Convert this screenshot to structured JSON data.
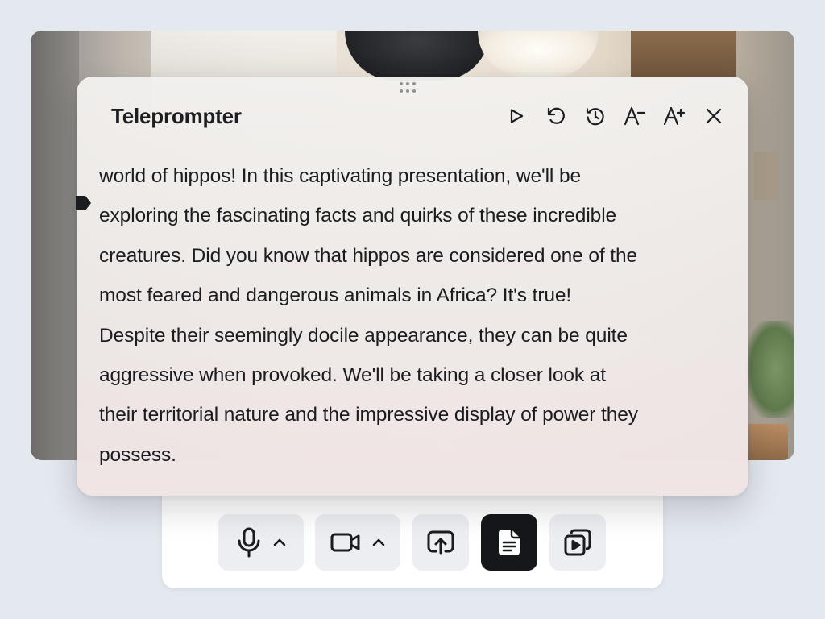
{
  "teleprompter": {
    "title": "Teleprompter",
    "controls": [
      {
        "icon": "play-icon",
        "label": "Play"
      },
      {
        "icon": "restart-icon",
        "label": "Restart"
      },
      {
        "icon": "clock-icon",
        "label": "Speed"
      },
      {
        "icon": "decrease-font-icon",
        "label": "Decrease font size"
      },
      {
        "icon": "increase-font-icon",
        "label": "Increase font size"
      },
      {
        "icon": "close-icon",
        "label": "Close"
      }
    ],
    "script_lines": [
      "world of hippos! In this captivating presentation, we'll be",
      "exploring the fascinating facts and quirks of these incredible",
      "creatures. Did you know that hippos are considered one of the",
      "most feared and dangerous animals in Africa? It's true!",
      "Despite their seemingly docile appearance, they can be quite",
      "aggressive when provoked. We'll be taking a closer look at",
      "their territorial nature and the impressive display of power they",
      "possess."
    ]
  },
  "toolbar": {
    "buttons": [
      {
        "icon": "microphone-icon",
        "has_caret": true,
        "active": false
      },
      {
        "icon": "camera-icon",
        "has_caret": true,
        "active": false
      },
      {
        "icon": "screen-share-icon",
        "has_caret": false,
        "active": false
      },
      {
        "icon": "document-icon",
        "has_caret": false,
        "active": true
      },
      {
        "icon": "media-library-icon",
        "has_caret": false,
        "active": false
      }
    ]
  },
  "colors": {
    "background": "#e4e8ef",
    "panel": "#f0eeec",
    "text": "#1b1c20",
    "button": "#eceef2",
    "button_active": "#15171b"
  }
}
